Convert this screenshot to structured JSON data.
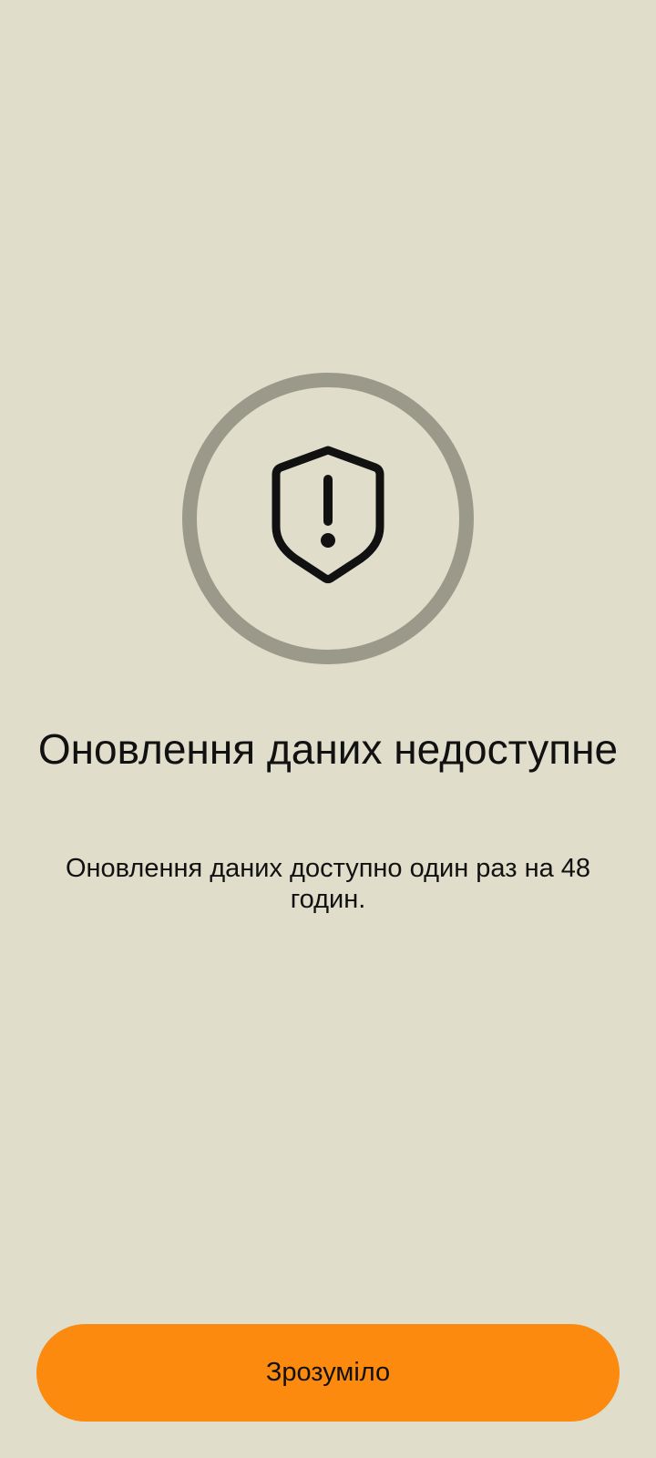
{
  "screen": {
    "icon": "shield-alert-icon",
    "title": "Оновлення даних недоступне",
    "description": "Оновлення даних доступно один раз на 48 годин.",
    "confirm_label": "Зрозуміло"
  },
  "colors": {
    "background": "#e0ddca",
    "ring": "#9a998a",
    "accent_button": "#fb8a0e",
    "text": "#111111"
  }
}
